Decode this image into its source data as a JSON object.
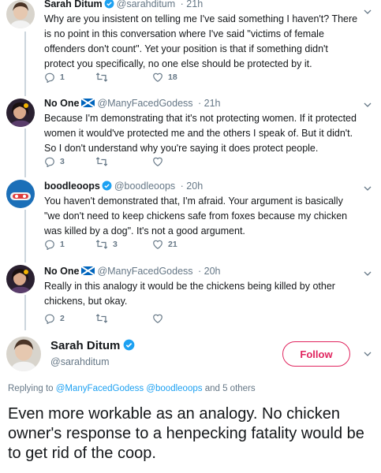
{
  "colors": {
    "accent": "#1da1f2",
    "follow": "#e0245e",
    "muted": "#657786",
    "text": "#14171a",
    "divider": "#e6ecf0"
  },
  "tweets": [
    {
      "name": "Sarah Ditum",
      "verified": true,
      "handle": "@sarahditum",
      "time": "· 21h",
      "text": "Why are you insistent on telling me I've said something I haven't? There is no point in this conversation where I've said \"victims of female offenders don't count\". Yet your position is that if something didn't protect you specifically, no one else should be protected by it.",
      "replies": "1",
      "retweets": "",
      "likes": "18"
    },
    {
      "name": "No One",
      "flag": "scotland",
      "handle": "@ManyFacedGodess",
      "time": "· 21h",
      "text": "Because I'm demonstrating that it's not protecting women. If it protected women it would've protected me and the others I speak of. But it didn't. So I don't understand why you're saying it does protect people.",
      "replies": "3",
      "retweets": "",
      "likes": ""
    },
    {
      "name": "boodleoops",
      "verified": true,
      "handle": "@boodleoops",
      "time": "· 20h",
      "text": "You haven't demonstrated that, I'm afraid. Your argument is basically \"we don't need to keep chickens safe from foxes because my chicken was killed by a dog\". It's not a good argument.",
      "replies": "1",
      "retweets": "3",
      "likes": "21"
    },
    {
      "name": "No One",
      "flag": "scotland",
      "handle": "@ManyFacedGodess",
      "time": "· 20h",
      "text": "Really in this analogy it would be the chickens being killed by other chickens, but okay.",
      "replies": "2",
      "retweets": "",
      "likes": ""
    }
  ],
  "main_tweet": {
    "name": "Sarah Ditum",
    "handle": "@sarahditum",
    "follow_label": "Follow",
    "replying_prefix": "Replying to",
    "replying_user1": "@ManyFacedGodess",
    "replying_user2": "@boodleoops",
    "replying_suffix": "and 5 others",
    "text": "Even more workable as an analogy. No chicken owner's response to a henpecking fatality would be to get rid of the coop."
  }
}
